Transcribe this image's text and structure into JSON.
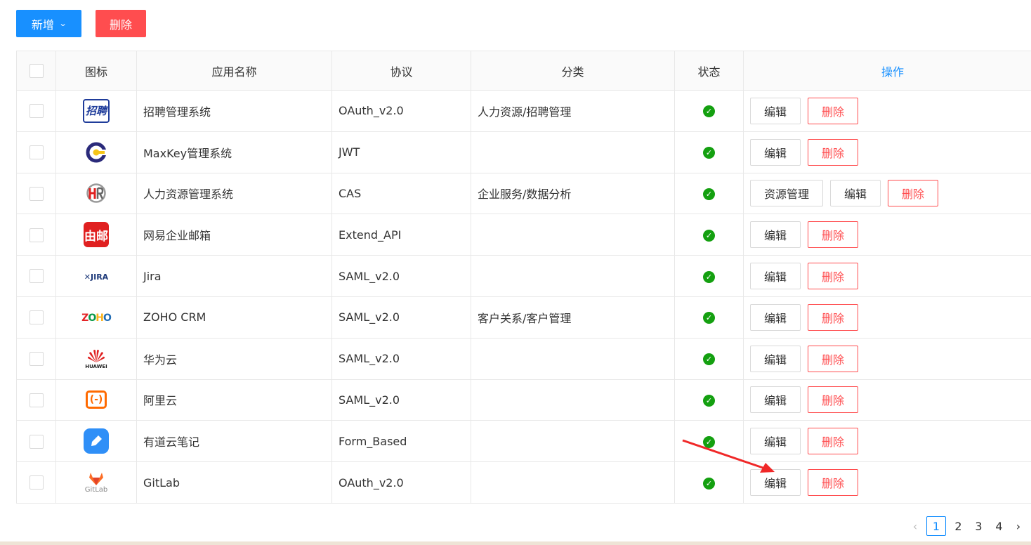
{
  "toolbar": {
    "add_label": "新增",
    "delete_label": "删除"
  },
  "table": {
    "headers": {
      "icon": "图标",
      "name": "应用名称",
      "protocol": "协议",
      "category": "分类",
      "status": "状态",
      "operation": "操作"
    },
    "rows": [
      {
        "icon": "zhaopin-icon",
        "name": "招聘管理系统",
        "protocol": "OAuth_v2.0",
        "category": "人力资源/招聘管理",
        "status": "enabled",
        "edit": "编辑",
        "delete": "删除"
      },
      {
        "icon": "maxkey-icon",
        "name": "MaxKey管理系统",
        "protocol": "JWT",
        "category": "",
        "status": "enabled",
        "edit": "编辑",
        "delete": "删除"
      },
      {
        "icon": "hr-icon",
        "name": "人力资源管理系统",
        "protocol": "CAS",
        "category": "企业服务/数据分析",
        "status": "enabled",
        "resource": "资源管理",
        "edit": "编辑",
        "delete": "删除"
      },
      {
        "icon": "netease-mail-icon",
        "name": "网易企业邮箱",
        "protocol": "Extend_API",
        "category": "",
        "status": "enabled",
        "edit": "编辑",
        "delete": "删除"
      },
      {
        "icon": "jira-icon",
        "name": "Jira",
        "protocol": "SAML_v2.0",
        "category": "",
        "status": "enabled",
        "edit": "编辑",
        "delete": "删除"
      },
      {
        "icon": "zoho-icon",
        "name": "ZOHO CRM",
        "protocol": "SAML_v2.0",
        "category": "客户关系/客户管理",
        "status": "enabled",
        "edit": "编辑",
        "delete": "删除"
      },
      {
        "icon": "huawei-icon",
        "name": "华为云",
        "protocol": "SAML_v2.0",
        "category": "",
        "status": "enabled",
        "edit": "编辑",
        "delete": "删除"
      },
      {
        "icon": "aliyun-icon",
        "name": "阿里云",
        "protocol": "SAML_v2.0",
        "category": "",
        "status": "enabled",
        "edit": "编辑",
        "delete": "删除"
      },
      {
        "icon": "youdao-icon",
        "name": "有道云笔记",
        "protocol": "Form_Based",
        "category": "",
        "status": "enabled",
        "edit": "编辑",
        "delete": "删除"
      },
      {
        "icon": "gitlab-icon",
        "name": "GitLab",
        "protocol": "OAuth_v2.0",
        "category": "",
        "status": "enabled",
        "edit": "编辑",
        "delete": "删除"
      }
    ]
  },
  "icon_text": {
    "zhaopin": "招聘",
    "netease_mail": "由邮",
    "jira": "JIRA",
    "zoho": "ZOHO",
    "huawei": "HUAWEI",
    "aliyun": "(-)",
    "gitlab": "GitLab"
  },
  "pagination": {
    "pages": [
      "1",
      "2",
      "3",
      "4"
    ],
    "current": "1"
  },
  "colors": {
    "primary": "#1890ff",
    "danger": "#ff4d4f",
    "success": "#14a010"
  }
}
